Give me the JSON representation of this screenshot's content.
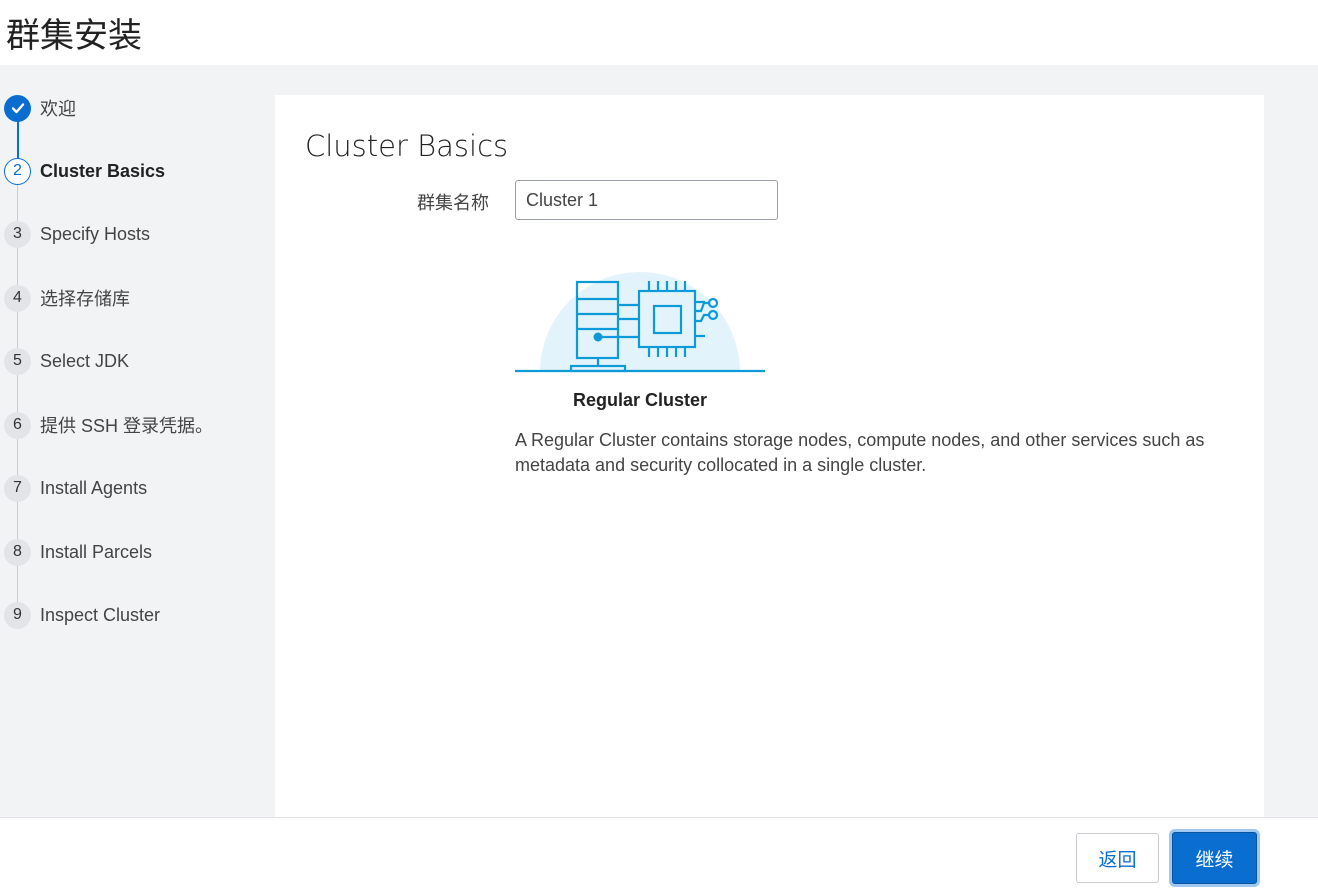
{
  "header": {
    "title": "群集安装"
  },
  "steps": [
    {
      "num": "",
      "label": "欢迎",
      "state": "done"
    },
    {
      "num": "2",
      "label": "Cluster Basics",
      "state": "active"
    },
    {
      "num": "3",
      "label": "Specify Hosts",
      "state": "pending"
    },
    {
      "num": "4",
      "label": "选择存储库",
      "state": "pending"
    },
    {
      "num": "5",
      "label": "Select JDK",
      "state": "pending"
    },
    {
      "num": "6",
      "label": "提供 SSH 登录凭据。",
      "state": "pending"
    },
    {
      "num": "7",
      "label": "Install Agents",
      "state": "pending"
    },
    {
      "num": "8",
      "label": "Install Parcels",
      "state": "pending"
    },
    {
      "num": "9",
      "label": "Inspect Cluster",
      "state": "pending"
    }
  ],
  "main": {
    "heading": "Cluster Basics",
    "cluster_name_label": "群集名称",
    "cluster_name_value": "Cluster 1",
    "cluster_type": "Regular Cluster",
    "cluster_description": "A Regular Cluster contains storage nodes, compute nodes, and other services such as metadata and security collocated in a single cluster.",
    "illustration_icon": "cluster-server-chip-icon"
  },
  "footer": {
    "back_label": "返回",
    "continue_label": "继续"
  },
  "colors": {
    "accent": "#0a6ed1",
    "illustration_bg": "#e3f3fb",
    "illustration_line": "#0d9ad8"
  }
}
